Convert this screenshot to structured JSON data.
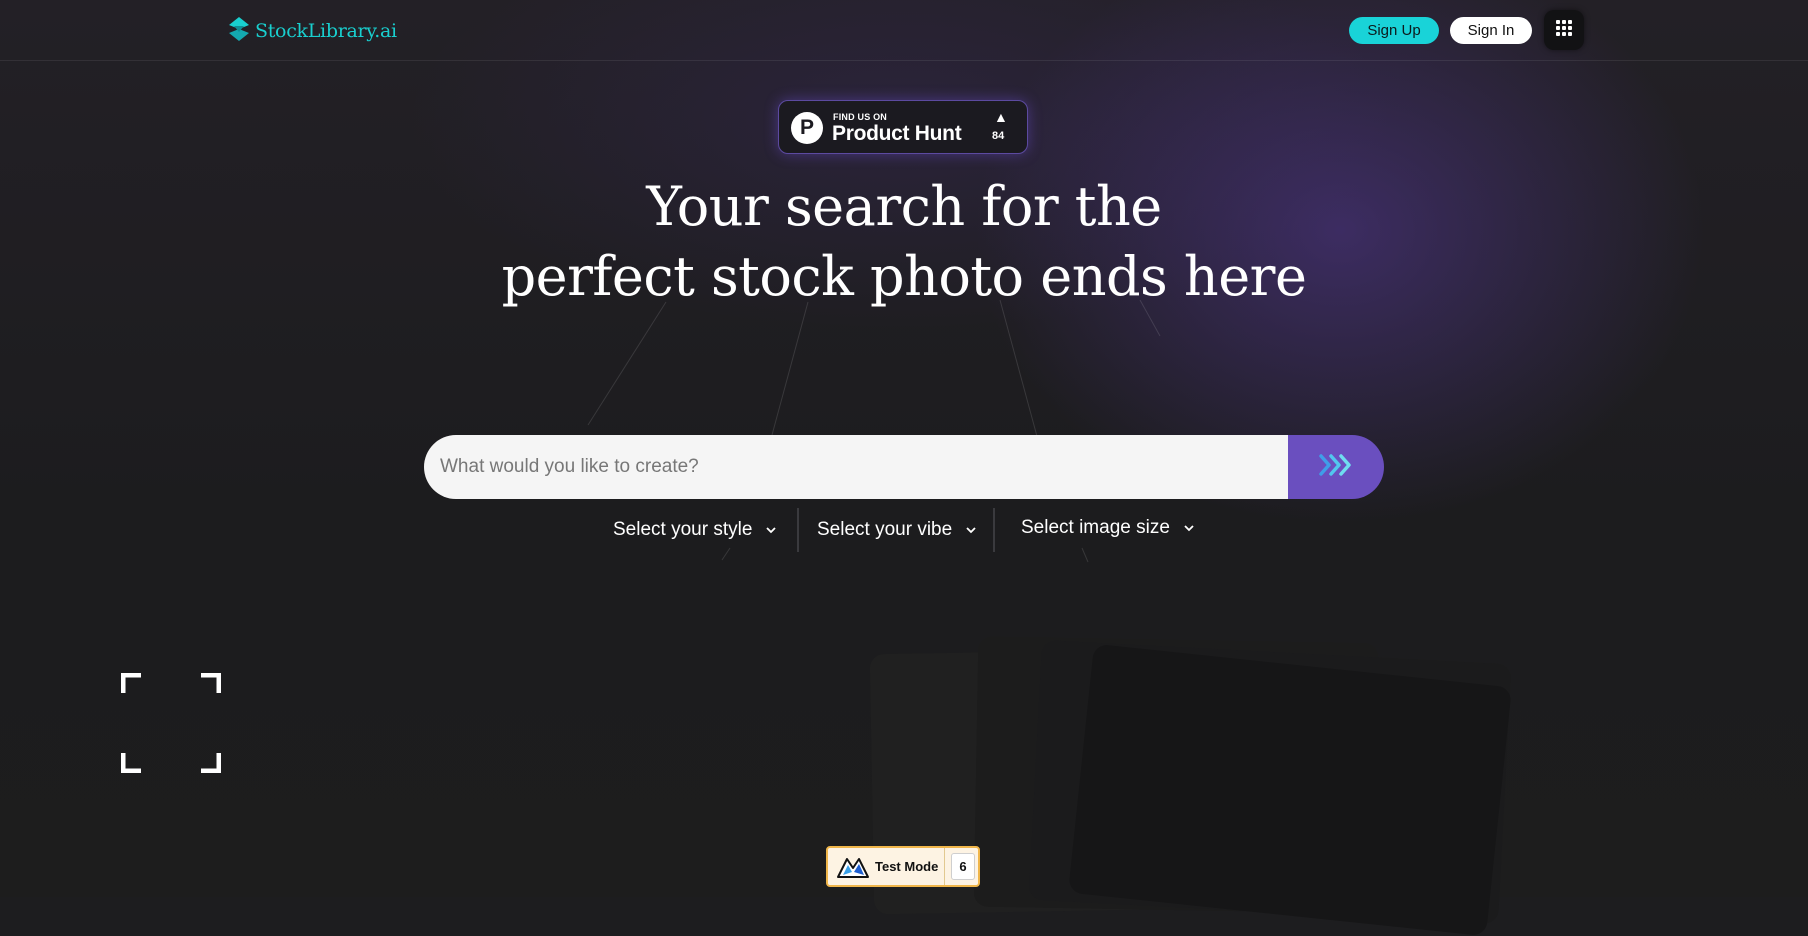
{
  "header": {
    "logo_text": "StockLibrary.ai",
    "signup_label": "Sign Up",
    "signin_label": "Sign In"
  },
  "product_hunt": {
    "small_text": "FIND US ON",
    "big_text": "Product Hunt",
    "logo_letter": "P",
    "upvote_arrow": "▲",
    "count": "84"
  },
  "hero": {
    "line1": "Your search for the",
    "line2": "perfect stock photo ends here"
  },
  "search": {
    "placeholder": "What would you like to create?"
  },
  "selects": {
    "style": "Select your style",
    "vibe": "Select your vibe",
    "size": "Select image size"
  },
  "test_mode": {
    "label": "Test Mode",
    "count": "6"
  },
  "colors": {
    "accent_teal": "#19d3d8",
    "accent_purple": "#6a4fbf",
    "background": "#1d1d1f"
  },
  "icons": {
    "logo": "stacked-diamond-icon",
    "apps": "grid-dots-icon",
    "submit": "triple-chevron-right-icon",
    "select_chevron": "chevron-down-icon",
    "expand": "expand-corners-icon",
    "test_mode_logo": "mountain-logo-icon"
  }
}
